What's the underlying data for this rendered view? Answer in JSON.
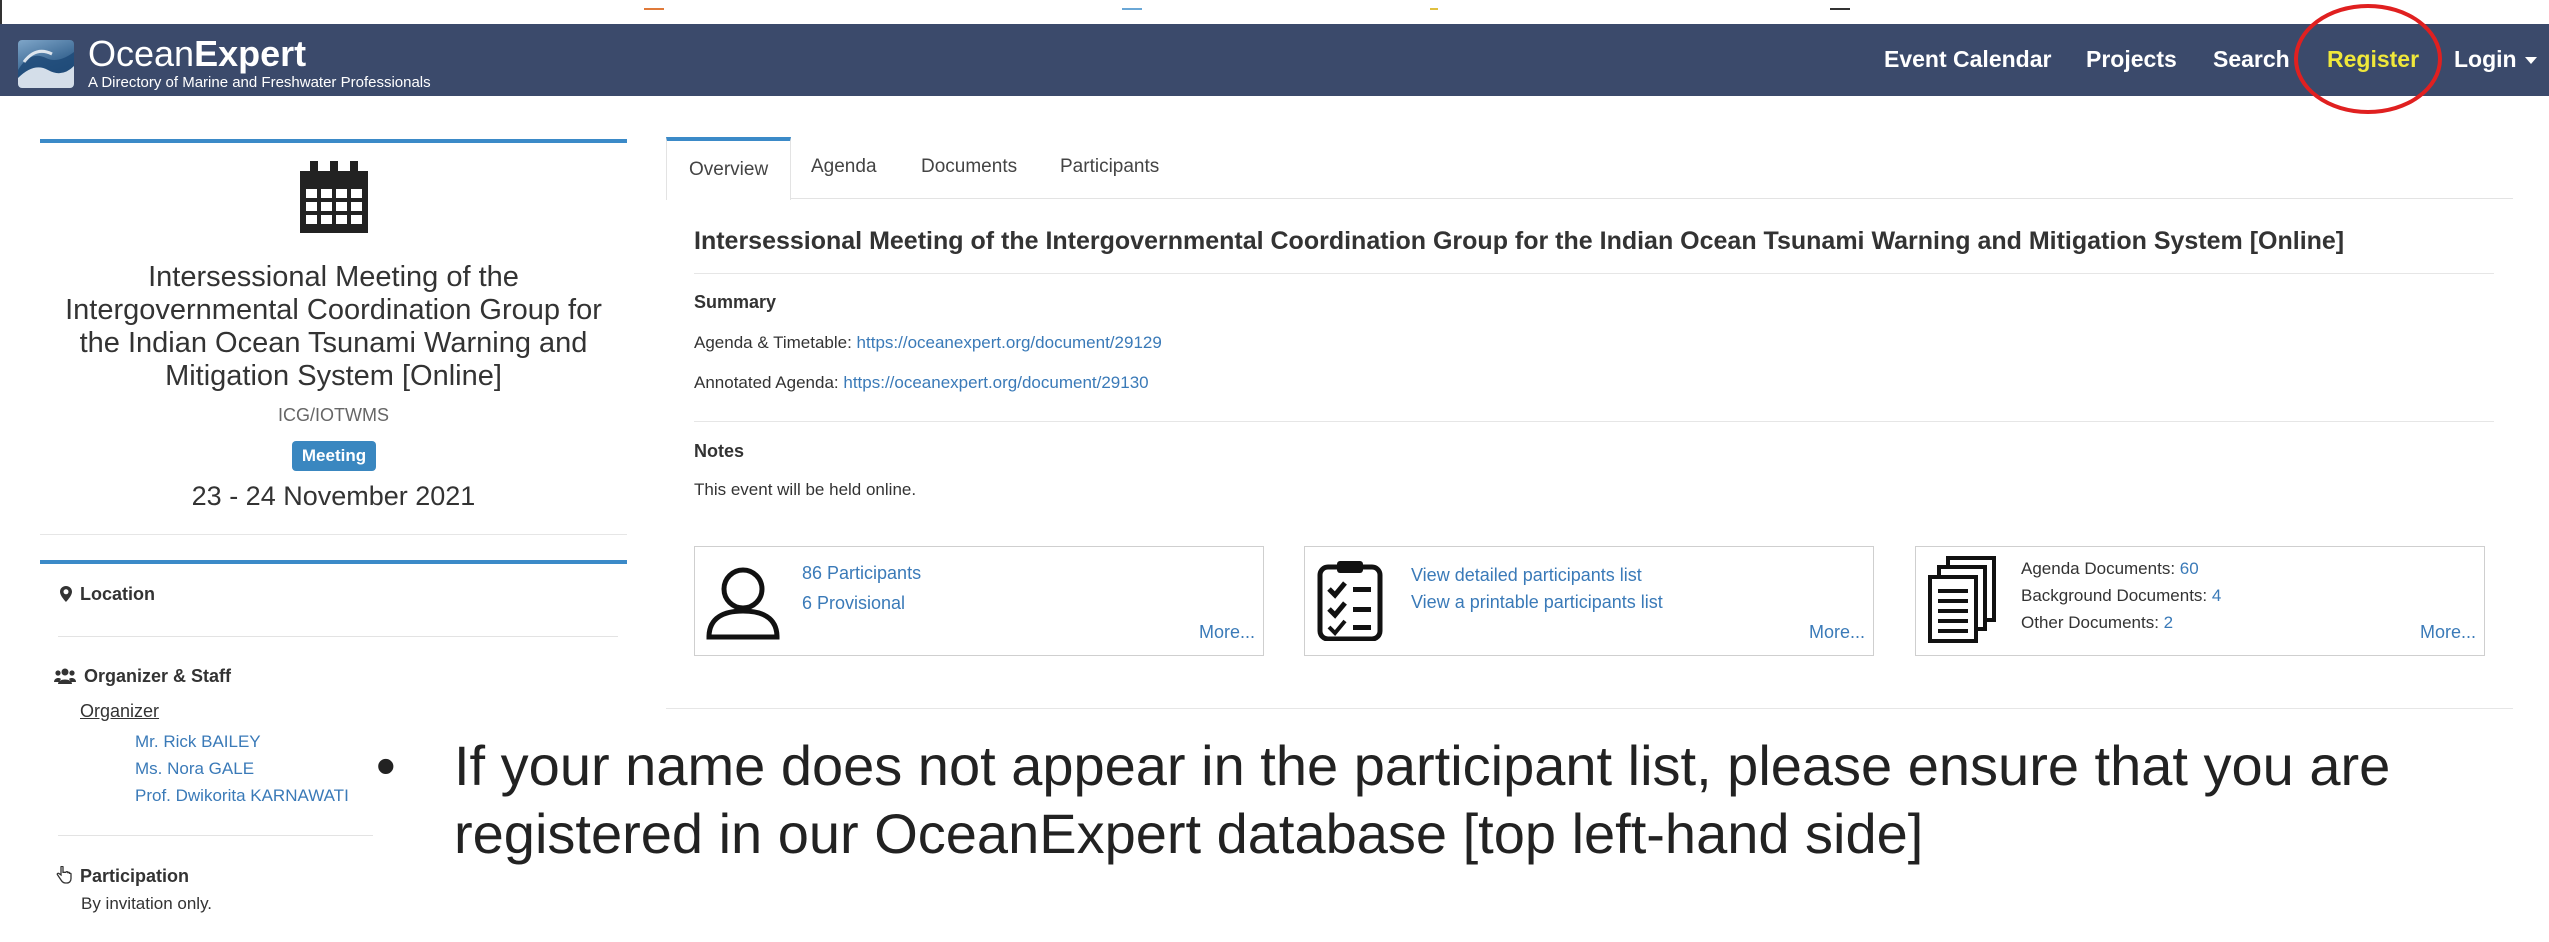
{
  "navbar": {
    "brand_light": "Ocean",
    "brand_bold": "Expert",
    "tagline": "A Directory of Marine and Freshwater Professionals",
    "items": [
      "Event Calendar",
      "Projects",
      "Search",
      "Register",
      "Login"
    ]
  },
  "event": {
    "title": "Intersessional Meeting of the Intergovernmental Coordination Group for the Indian Ocean Tsunami Warning and Mitigation System [Online]",
    "acronym": "ICG/IOTWMS",
    "badge": "Meeting",
    "dates": "23 - 24 November 2021"
  },
  "sidebar": {
    "location_heading": "Location",
    "organizer_heading": "Organizer & Staff",
    "organizer_label": "Organizer",
    "staff": [
      "Mr. Rick BAILEY",
      "Ms. Nora GALE",
      "Prof. Dwikorita KARNAWATI"
    ],
    "participation_heading": "Participation",
    "participation_text": "By invitation only."
  },
  "tabs": [
    "Overview",
    "Agenda",
    "Documents",
    "Participants"
  ],
  "overview": {
    "title": "Intersessional Meeting of the Intergovernmental Coordination Group for the Indian Ocean Tsunami Warning and Mitigation System [Online]",
    "summary_label": "Summary",
    "agenda_timetable_label": "Agenda & Timetable: ",
    "agenda_timetable_link": "https://oceanexpert.org/document/29129",
    "annotated_agenda_label": "Annotated Agenda: ",
    "annotated_agenda_link": "https://oceanexpert.org/document/29130",
    "notes_label": "Notes",
    "notes_text": "This event will be held online."
  },
  "participants_box": {
    "participants": "86 Participants",
    "provisional": "6 Provisional",
    "more": "More..."
  },
  "lists_box": {
    "detailed": "View detailed participants list",
    "printable": "View a printable participants list",
    "more": "More..."
  },
  "documents_box": {
    "agenda_label": "Agenda Documents: ",
    "agenda_count": "60",
    "background_label": "Background Documents: ",
    "background_count": "4",
    "other_label": "Other Documents: ",
    "other_count": "2",
    "more": "More..."
  },
  "annotation": {
    "bullet": "•",
    "text": "If your name does not appear in the participant list, please ensure that you are registered in our OceanExpert database [top left-hand side]",
    "highlight_color": "#e02020"
  }
}
